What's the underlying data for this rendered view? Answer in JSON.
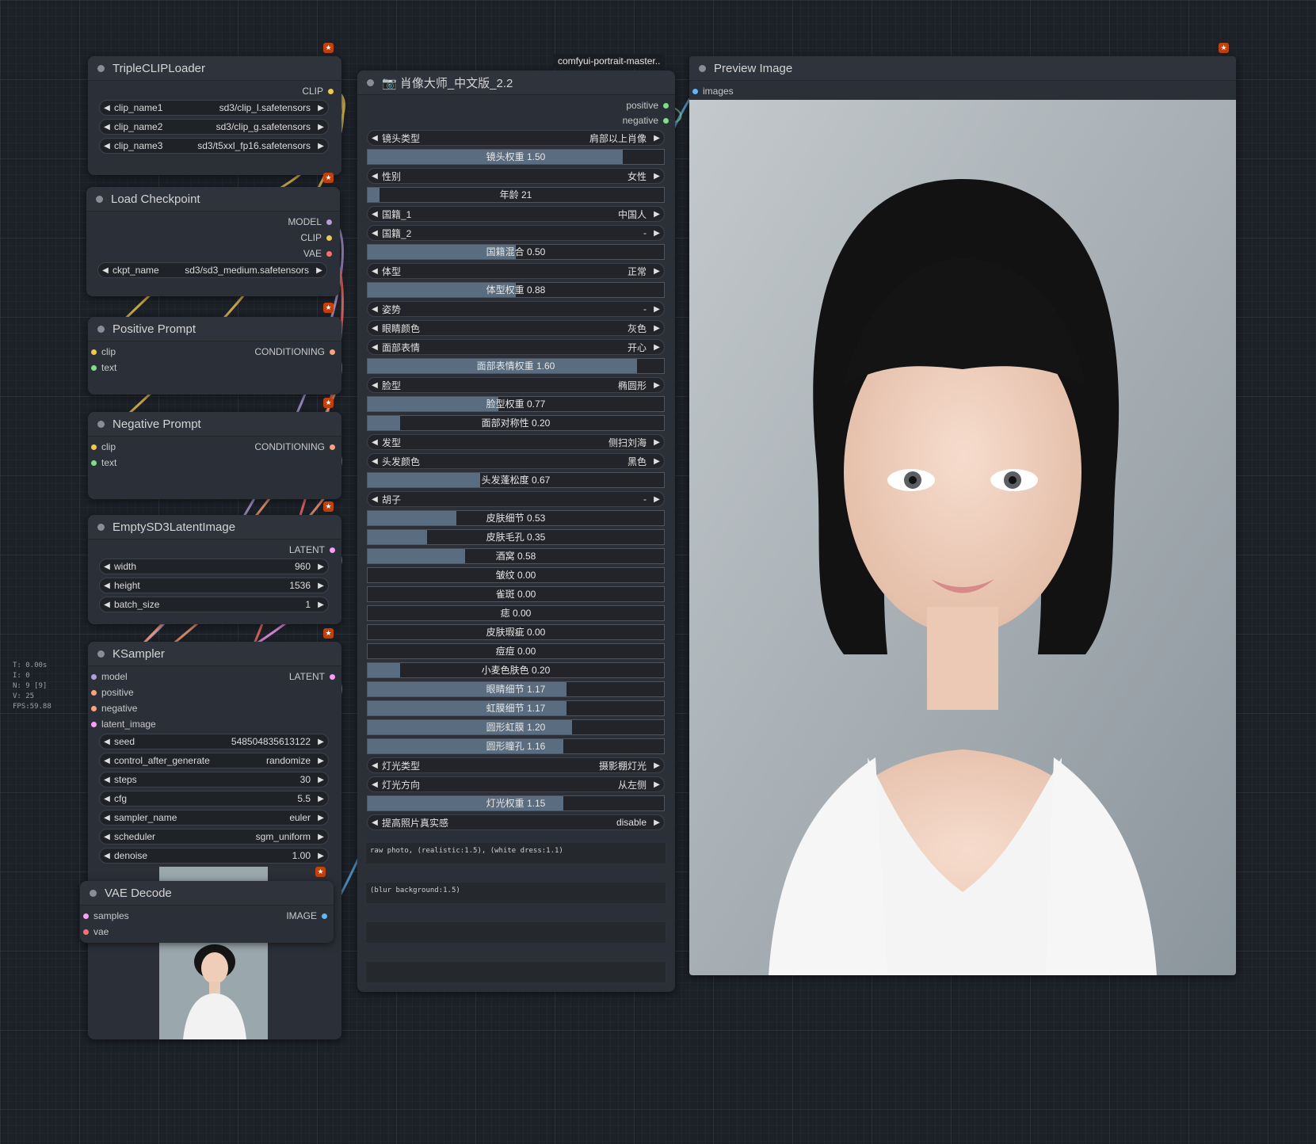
{
  "stats": [
    "T: 0.00s",
    "I: 0",
    "N: 9 [9]",
    "V: 25",
    "FPS:59.88"
  ],
  "triple_clip": {
    "title": "TripleCLIPLoader",
    "output": "CLIP",
    "widgets": [
      {
        "label": "clip_name1",
        "value": "sd3/clip_l.safetensors"
      },
      {
        "label": "clip_name2",
        "value": "sd3/clip_g.safetensors"
      },
      {
        "label": "clip_name3",
        "value": "sd3/t5xxl_fp16.safetensors"
      }
    ]
  },
  "load_checkpoint": {
    "title": "Load Checkpoint",
    "outputs": [
      "MODEL",
      "CLIP",
      "VAE"
    ],
    "ckpt_label": "ckpt_name",
    "ckpt_value": "sd3/sd3_medium.safetensors"
  },
  "positive_prompt": {
    "title": "Positive Prompt",
    "in1": "clip",
    "in2": "text",
    "out": "CONDITIONING"
  },
  "negative_prompt": {
    "title": "Negative Prompt",
    "in1": "clip",
    "in2": "text",
    "out": "CONDITIONING"
  },
  "empty_latent": {
    "title": "EmptySD3LatentImage",
    "output": "LATENT",
    "widgets": [
      {
        "label": "width",
        "value": "960"
      },
      {
        "label": "height",
        "value": "1536"
      },
      {
        "label": "batch_size",
        "value": "1"
      }
    ]
  },
  "ksampler": {
    "title": "KSampler",
    "inputs": [
      "model",
      "positive",
      "negative",
      "latent_image"
    ],
    "output": "LATENT",
    "widgets": [
      {
        "label": "seed",
        "value": "548504835613122"
      },
      {
        "label": "control_after_generate",
        "value": "randomize"
      },
      {
        "label": "steps",
        "value": "30"
      },
      {
        "label": "cfg",
        "value": "5.5"
      },
      {
        "label": "sampler_name",
        "value": "euler"
      },
      {
        "label": "scheduler",
        "value": "sgm_uniform"
      },
      {
        "label": "denoise",
        "value": "1.00"
      }
    ]
  },
  "vae_decode": {
    "title": "VAE Decode",
    "in1": "samples",
    "in2": "vae",
    "out": "IMAGE"
  },
  "portrait": {
    "badge": "comfyui-portrait-master..",
    "title": "📷 肖像大师_中文版_2.2",
    "outputs": [
      "positive",
      "negative"
    ],
    "rows": [
      {
        "kind": "combo",
        "label": "镜头类型",
        "value": "肩部以上肖像"
      },
      {
        "kind": "slider",
        "text": "镜头权重  1.50",
        "fill": 0.86
      },
      {
        "kind": "combo",
        "label": "性别",
        "value": "女性"
      },
      {
        "kind": "slider",
        "text": "年龄  21",
        "fill": 0.04
      },
      {
        "kind": "combo",
        "label": "国籍_1",
        "value": "中国人"
      },
      {
        "kind": "combo",
        "label": "国籍_2",
        "value": "-"
      },
      {
        "kind": "slider",
        "text": "国籍混合  0.50",
        "fill": 0.5
      },
      {
        "kind": "combo",
        "label": "体型",
        "value": "正常"
      },
      {
        "kind": "slider",
        "text": "体型权重  0.88",
        "fill": 0.5
      },
      {
        "kind": "combo",
        "label": "姿势",
        "value": "-"
      },
      {
        "kind": "combo",
        "label": "眼睛颜色",
        "value": "灰色"
      },
      {
        "kind": "combo",
        "label": "面部表情",
        "value": "开心"
      },
      {
        "kind": "slider",
        "text": "面部表情权重  1.60",
        "fill": 0.91
      },
      {
        "kind": "combo",
        "label": "脸型",
        "value": "椭圆形"
      },
      {
        "kind": "slider",
        "text": "脸型权重  0.77",
        "fill": 0.44
      },
      {
        "kind": "slider",
        "text": "面部对称性  0.20",
        "fill": 0.11
      },
      {
        "kind": "combo",
        "label": "发型",
        "value": "侧扫刘海"
      },
      {
        "kind": "combo",
        "label": "头发颜色",
        "value": "黑色"
      },
      {
        "kind": "slider",
        "text": "头发蓬松度  0.67",
        "fill": 0.38
      },
      {
        "kind": "combo",
        "label": "胡子",
        "value": "-"
      },
      {
        "kind": "slider",
        "text": "皮肤细节  0.53",
        "fill": 0.3
      },
      {
        "kind": "slider",
        "text": "皮肤毛孔  0.35",
        "fill": 0.2
      },
      {
        "kind": "slider",
        "text": "酒窝  0.58",
        "fill": 0.33
      },
      {
        "kind": "slider",
        "text": "皱纹  0.00",
        "fill": 0
      },
      {
        "kind": "slider",
        "text": "雀斑  0.00",
        "fill": 0
      },
      {
        "kind": "slider",
        "text": "痣  0.00",
        "fill": 0
      },
      {
        "kind": "slider",
        "text": "皮肤瑕疵  0.00",
        "fill": 0
      },
      {
        "kind": "slider",
        "text": "痘痘  0.00",
        "fill": 0
      },
      {
        "kind": "slider",
        "text": "小麦色肤色  0.20",
        "fill": 0.11
      },
      {
        "kind": "slider",
        "text": "眼睛细节  1.17",
        "fill": 0.67
      },
      {
        "kind": "slider",
        "text": "虹膜细节  1.17",
        "fill": 0.67
      },
      {
        "kind": "slider",
        "text": "圆形虹膜  1.20",
        "fill": 0.69
      },
      {
        "kind": "slider",
        "text": "圆形瞳孔  1.16",
        "fill": 0.66
      },
      {
        "kind": "combo",
        "label": "灯光类型",
        "value": "摄影棚灯光"
      },
      {
        "kind": "combo",
        "label": "灯光方向",
        "value": "从左侧"
      },
      {
        "kind": "slider",
        "text": "灯光权重  1.15",
        "fill": 0.66
      },
      {
        "kind": "combo",
        "label": "提高照片真实感",
        "value": "disable"
      }
    ],
    "text1": "raw photo, (realistic:1.5), (white dress:1.1)",
    "text2": "(blur background:1.5)"
  },
  "preview": {
    "title": "Preview Image",
    "input": "images"
  },
  "colors": {
    "clip": "#f0c850",
    "model": "#b39ddb",
    "vae": "#ff6e6e",
    "conditioning": "#ffa07a",
    "latent": "#ff9cf9",
    "image": "#64b5f6",
    "text": "#7ee080",
    "slider_fill": "#5a6d80",
    "badge": "#c2410c"
  }
}
